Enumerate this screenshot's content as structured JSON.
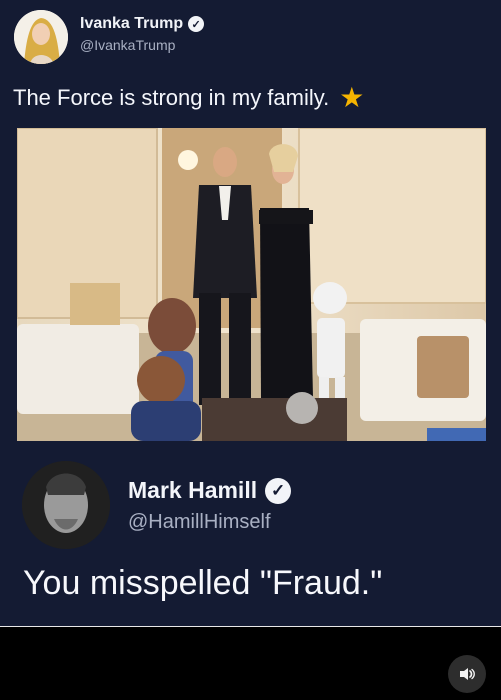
{
  "tweet1": {
    "display_name": "Ivanka Trump",
    "handle": "@IvankaTrump",
    "text": "The Force is strong in my family.",
    "emoji": "★"
  },
  "tweet2": {
    "display_name": "Mark Hamill",
    "handle": "@HamillHimself",
    "text": "You misspelled \"Fraud.\""
  },
  "colors": {
    "card_background": "#141b33",
    "accent_star": "#f5b400"
  },
  "icons": {
    "verified": "verified-badge-icon",
    "sound": "speaker-icon"
  }
}
